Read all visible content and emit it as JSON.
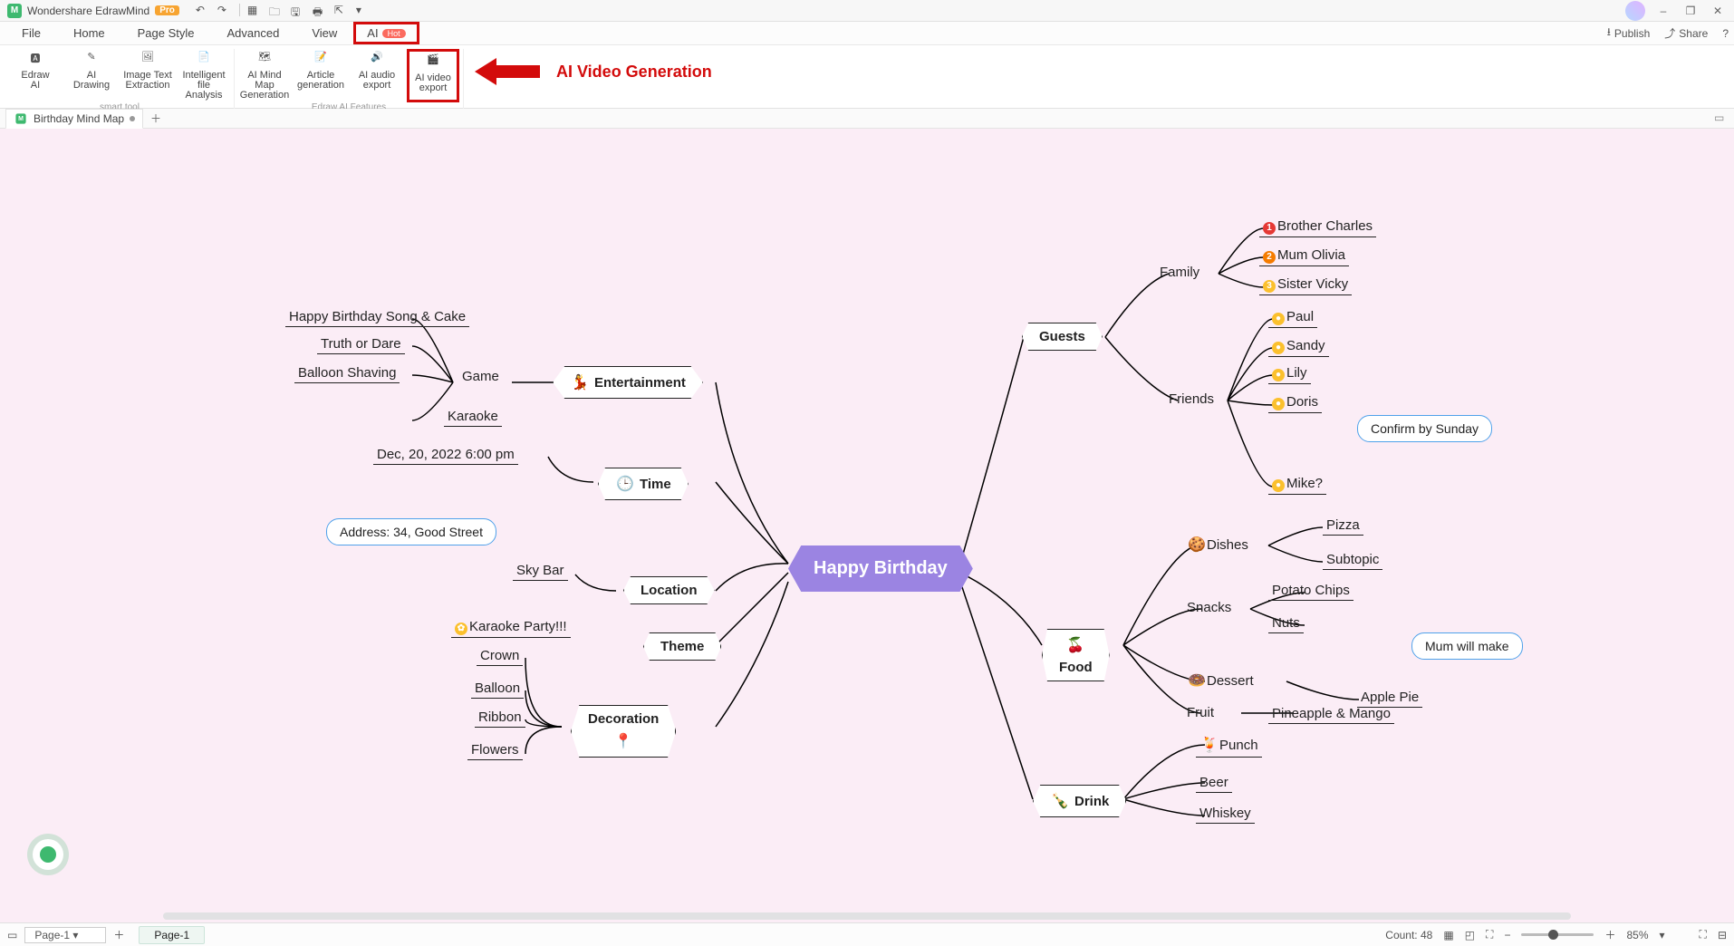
{
  "app": {
    "name": "Wondershare EdrawMind",
    "edition": "Pro",
    "window_controls": {
      "minimize": "–",
      "maximize": "❐",
      "close": "✕"
    }
  },
  "menu": {
    "items": [
      "File",
      "Home",
      "Page Style",
      "Advanced",
      "View",
      "AI"
    ],
    "ai_badge": "Hot",
    "right": {
      "publish": "Publish",
      "share": "Share"
    }
  },
  "ribbon": {
    "group1_name": "smart tool",
    "group2_name": "Edraw AI Features",
    "buttons": [
      {
        "label": "Edraw\nAI"
      },
      {
        "label": "AI\nDrawing"
      },
      {
        "label": "Image Text\nExtraction"
      },
      {
        "label": "Intelligent\nfile Analysis"
      },
      {
        "label": "AI Mind Map\nGeneration"
      },
      {
        "label": "Article\ngeneration"
      },
      {
        "label": "AI audio\nexport"
      },
      {
        "label": "AI video\nexport"
      }
    ],
    "annotation": "AI Video Generation"
  },
  "doc_tab": {
    "name": "Birthday Mind Map"
  },
  "mindmap": {
    "central": "Happy Birthday",
    "entertainment": {
      "title": "Entertainment",
      "game": "Game",
      "items": [
        "Happy Birthday Song & Cake",
        "Truth or Dare",
        "Balloon Shaving",
        "Karaoke"
      ]
    },
    "time": {
      "title": "Time",
      "value": "Dec, 20, 2022 6:00 pm"
    },
    "location": {
      "title": "Location",
      "addr": "Address: 34, Good Street",
      "bar": "Sky Bar"
    },
    "theme": {
      "title": "Theme",
      "value": "Karaoke Party!!!"
    },
    "decoration": {
      "title": "Decoration",
      "items": [
        "Crown",
        "Balloon",
        "Ribbon",
        "Flowers"
      ]
    },
    "guests": {
      "title": "Guests",
      "family": "Family",
      "friends": "Friends",
      "family_items": [
        "Brother Charles",
        "Mum Olivia",
        "Sister Vicky"
      ],
      "friends_items": [
        "Paul",
        "Sandy",
        "Lily",
        "Doris",
        "Mike?"
      ],
      "callout": "Confirm by Sunday"
    },
    "food": {
      "title": "Food",
      "dishes": "Dishes",
      "snacks": "Snacks",
      "dessert": "Dessert",
      "fruit": "Fruit",
      "dishes_items": [
        "Pizza",
        "Subtopic"
      ],
      "snacks_items": [
        "Potato Chips",
        "Nuts"
      ],
      "dessert_items": [
        "Apple Pie"
      ],
      "fruit_items": [
        "Pineapple & Mango"
      ],
      "callout": "Mum will make"
    },
    "drink": {
      "title": "Drink",
      "items": [
        "Punch",
        "Beer",
        "Whiskey"
      ]
    }
  },
  "status": {
    "page_select": "Page-1",
    "page_tab": "Page-1",
    "count_label": "Count:",
    "count": "48",
    "zoom": "85%"
  }
}
